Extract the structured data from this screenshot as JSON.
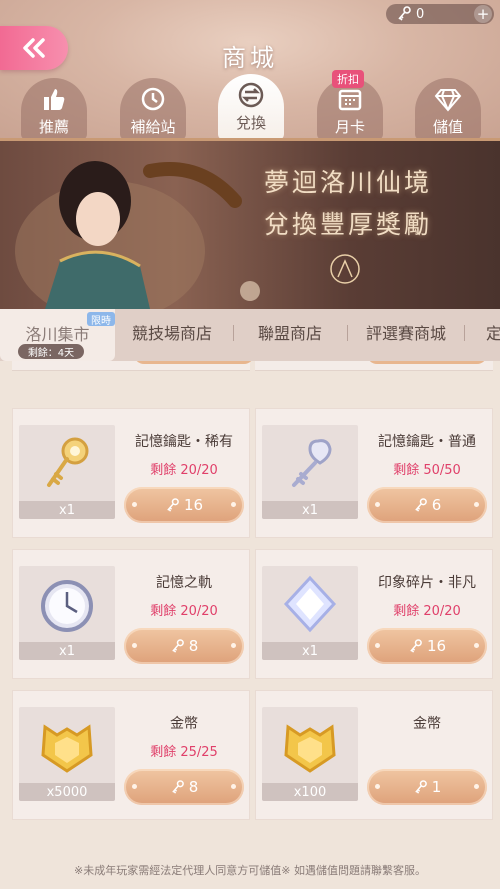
{
  "currency": {
    "value": "0",
    "icon": "key-icon",
    "plus": "+"
  },
  "header": {
    "title": "商城",
    "back_icon": "double-chevron-left-icon"
  },
  "tabs": [
    {
      "label": "推薦",
      "icon": "thumbs-up-icon",
      "active": false
    },
    {
      "label": "補給站",
      "icon": "clock-icon",
      "active": false
    },
    {
      "label": "兌換",
      "icon": "exchange-icon",
      "active": true
    },
    {
      "label": "月卡",
      "icon": "calendar-icon",
      "active": false,
      "badge": "折扣"
    },
    {
      "label": "儲值",
      "icon": "diamond-icon",
      "active": false
    }
  ],
  "banner": {
    "line1": "夢迴洛川仙境",
    "line2": "兌換豐厚獎勵"
  },
  "subtabs": {
    "items": [
      "洛川集市",
      "競技場商店",
      "聯盟商店",
      "評選賽商城",
      "定"
    ],
    "limited_badge": "限時",
    "remaining": "剩餘：4天"
  },
  "items": [
    {
      "name": "記憶鑰匙・稀有",
      "stock": "剩餘 20/20",
      "qty": "x1",
      "price": "16",
      "icon": "gold-key-icon"
    },
    {
      "name": "記憶鑰匙・普通",
      "stock": "剩餘 50/50",
      "qty": "x1",
      "price": "6",
      "icon": "silver-key-icon"
    },
    {
      "name": "記憶之軌",
      "stock": "剩餘 20/20",
      "qty": "x1",
      "price": "8",
      "icon": "clock-icon"
    },
    {
      "name": "印象碎片・非凡",
      "stock": "剩餘 20/20",
      "qty": "x1",
      "price": "16",
      "icon": "crystal-icon"
    },
    {
      "name": "金幣",
      "stock": "剩餘 25/25",
      "qty": "x5000",
      "price": "8",
      "icon": "gold-coin-icon"
    },
    {
      "name": "金幣",
      "stock": "",
      "qty": "x100",
      "price": "1",
      "icon": "gold-coin-icon"
    }
  ],
  "footer": {
    "note": "※未成年玩家需經法定代理人同意方可儲值※ 如遇儲值問題請聯繫客服。"
  }
}
